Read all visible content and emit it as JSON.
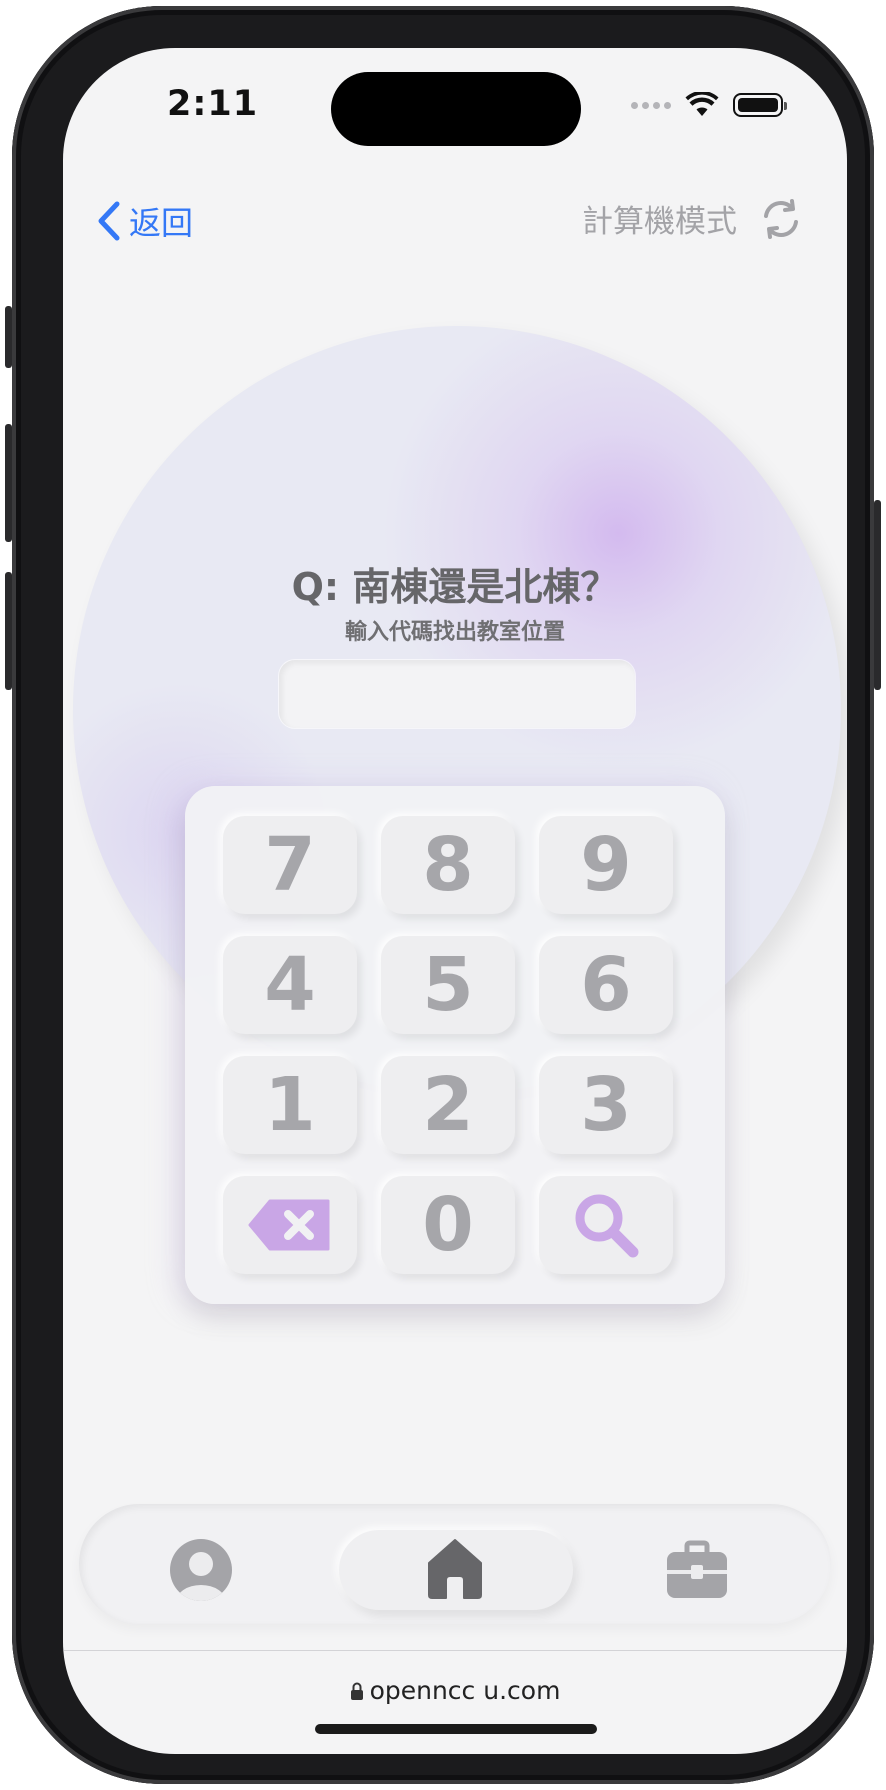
{
  "status_bar": {
    "time": "2:11"
  },
  "nav": {
    "back_label": "返回",
    "mode_label": "計算機模式"
  },
  "prompt": {
    "title": "Q: 南棟還是北棟？",
    "subtitle": "輸入代碼找出教室位置"
  },
  "code_input": {
    "value": ""
  },
  "keypad": {
    "keys": [
      "7",
      "8",
      "9",
      "4",
      "5",
      "6",
      "1",
      "2",
      "3",
      "0"
    ],
    "delete_icon": "backspace-icon",
    "search_icon": "search-icon"
  },
  "tab_bar": {
    "tabs": [
      {
        "icon": "profile-icon",
        "active": false
      },
      {
        "icon": "home-icon",
        "active": true
      },
      {
        "icon": "briefcase-icon",
        "active": false
      }
    ]
  },
  "browser": {
    "url": "openncc u.com"
  },
  "colors": {
    "accent": "#3478f6",
    "keypad_accent": "#c9a6e6",
    "key_text": "#a6a6aa"
  }
}
